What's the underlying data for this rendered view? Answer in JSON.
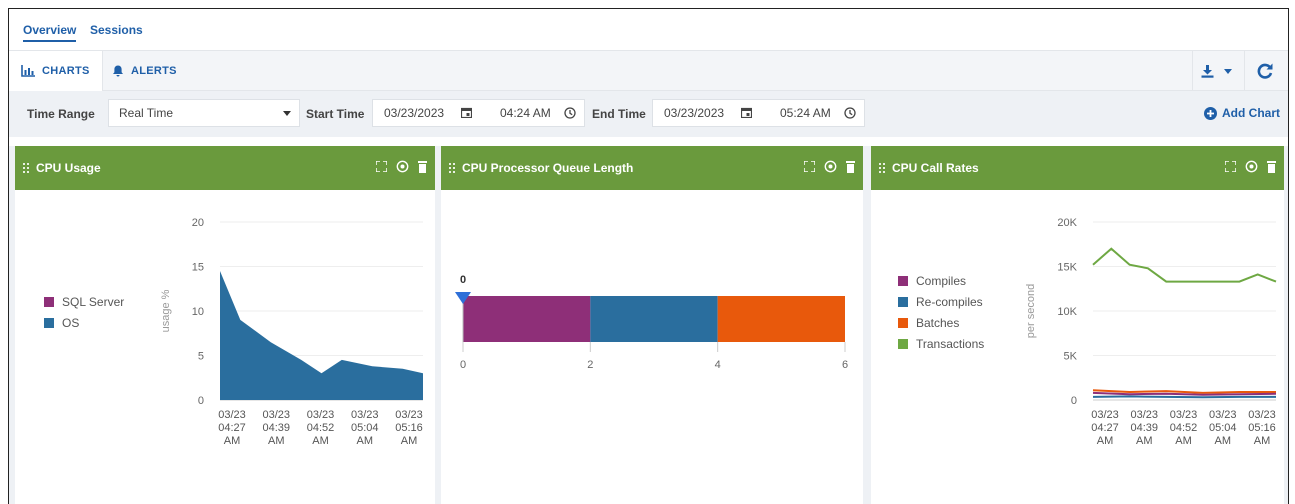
{
  "top_tabs": {
    "overview": "Overview",
    "sessions": "Sessions"
  },
  "sub_tabs": {
    "charts": "CHARTS",
    "alerts": "ALERTS"
  },
  "filters": {
    "time_range_label": "Time Range",
    "time_range_value": "Real Time",
    "start_time_label": "Start Time",
    "start_date": "03/23/2023",
    "start_time": "04:24 AM",
    "end_time_label": "End Time",
    "end_date": "03/23/2023",
    "end_time": "05:24 AM",
    "add_chart": "Add Chart"
  },
  "colors": {
    "header_green": "#6a9a3d",
    "link_blue": "#1f5fa8",
    "sql_server": "#8e2f78",
    "os": "#2a6e9e",
    "compiles": "#8e2f78",
    "recompiles": "#2a6e9e",
    "batches": "#e8590c",
    "transactions": "#6ea843"
  },
  "panels": {
    "cpu_usage_title": "CPU Usage",
    "queue_title": "CPU Processor Queue Length",
    "call_rates_title": "CPU Call Rates"
  },
  "chart_data": [
    {
      "type": "area",
      "title": "CPU Usage",
      "ylabel": "usage %",
      "ylim": [
        0,
        20
      ],
      "yticks": [
        "20",
        "15",
        "10",
        "5",
        "0"
      ],
      "x_ticks": [
        [
          "03/23",
          "04:27",
          "AM"
        ],
        [
          "03/23",
          "04:39",
          "AM"
        ],
        [
          "03/23",
          "04:52",
          "AM"
        ],
        [
          "03/23",
          "05:04",
          "AM"
        ],
        [
          "03/23",
          "05:16",
          "AM"
        ]
      ],
      "legend": [
        "SQL Server",
        "OS"
      ],
      "series": [
        {
          "name": "OS",
          "x": [
            0,
            0.1,
            0.25,
            0.4,
            0.5,
            0.6,
            0.75,
            0.9,
            1.0
          ],
          "values": [
            14.5,
            9,
            6.5,
            4.5,
            3,
            4.5,
            3.8,
            3.5,
            3
          ]
        },
        {
          "name": "SQL Server",
          "x": [
            0,
            1.0
          ],
          "values": [
            0,
            0
          ]
        }
      ]
    },
    {
      "type": "bar",
      "title": "CPU Processor Queue Length",
      "marker_label": "0",
      "xlim": [
        0,
        6
      ],
      "xticks": [
        "0",
        "2",
        "4",
        "6"
      ],
      "segments": [
        {
          "from": 0,
          "to": 2,
          "color": "#8e2f78"
        },
        {
          "from": 2,
          "to": 4,
          "color": "#2a6e9e"
        },
        {
          "from": 4,
          "to": 6,
          "color": "#e8590c"
        }
      ]
    },
    {
      "type": "line",
      "title": "CPU Call Rates",
      "ylabel": "per second",
      "ylim": [
        0,
        20000
      ],
      "yticks": [
        "20K",
        "15K",
        "10K",
        "5K",
        "0"
      ],
      "x_ticks": [
        [
          "03/23",
          "04:27",
          "AM"
        ],
        [
          "03/23",
          "04:39",
          "AM"
        ],
        [
          "03/23",
          "04:52",
          "AM"
        ],
        [
          "03/23",
          "05:04",
          "AM"
        ],
        [
          "03/23",
          "05:16",
          "AM"
        ]
      ],
      "legend": [
        "Compiles",
        "Re-compiles",
        "Batches",
        "Transactions"
      ],
      "series": [
        {
          "name": "Transactions",
          "x": [
            0,
            0.1,
            0.2,
            0.3,
            0.4,
            0.5,
            0.6,
            0.7,
            0.8,
            0.9,
            1.0
          ],
          "values": [
            15200,
            17000,
            15200,
            14800,
            13300,
            13300,
            13300,
            13300,
            13300,
            14100,
            13300
          ]
        },
        {
          "name": "Batches",
          "x": [
            0,
            0.2,
            0.4,
            0.6,
            0.8,
            1.0
          ],
          "values": [
            1100,
            900,
            1000,
            800,
            900,
            900
          ]
        },
        {
          "name": "Compiles",
          "x": [
            0,
            0.2,
            0.4,
            0.6,
            0.8,
            1.0
          ],
          "values": [
            800,
            650,
            700,
            600,
            650,
            700
          ]
        },
        {
          "name": "Re-compiles",
          "x": [
            0,
            0.2,
            0.4,
            0.6,
            0.8,
            1.0
          ],
          "values": [
            350,
            400,
            350,
            300,
            350,
            350
          ]
        }
      ]
    }
  ]
}
